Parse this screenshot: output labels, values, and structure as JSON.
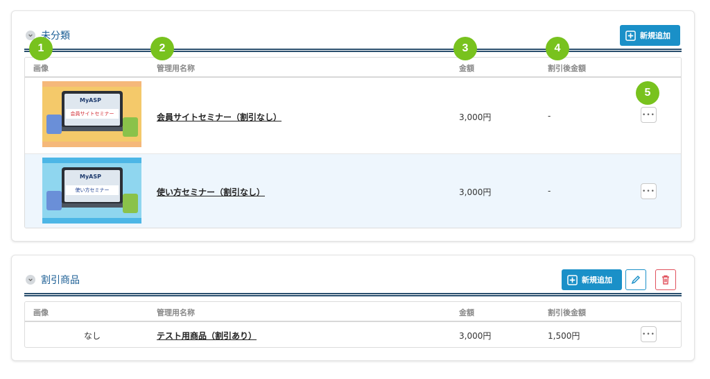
{
  "categories": [
    {
      "title": "未分類",
      "add_label": "新規追加",
      "headers": {
        "image": "画像",
        "name": "管理用名称",
        "price": "金額",
        "discount": "割引後金額"
      },
      "rows": [
        {
          "thumb_title": "会員サイトセミナー",
          "thumb_logo": "MyASP",
          "name": "会員サイトセミナー（割引なし）",
          "price": "3,000円",
          "discount": "-"
        },
        {
          "thumb_title": "使い方セミナー",
          "thumb_logo": "MyASP",
          "name": "使い方セミナー（割引なし）",
          "price": "3,000円",
          "discount": "-"
        }
      ]
    },
    {
      "title": "割引商品",
      "add_label": "新規追加",
      "headers": {
        "image": "画像",
        "name": "管理用名称",
        "price": "金額",
        "discount": "割引後金額"
      },
      "rows": [
        {
          "image_text": "なし",
          "name": "テスト用商品（割引あり）",
          "price": "3,000円",
          "discount": "1,500円"
        }
      ]
    }
  ],
  "badges": [
    "1",
    "2",
    "3",
    "4",
    "5"
  ],
  "more_glyph": "•••",
  "colors": {
    "accent": "#1a90c8",
    "badge": "#78c21e",
    "title": "#1a5d94",
    "delete": "#e0505c"
  }
}
